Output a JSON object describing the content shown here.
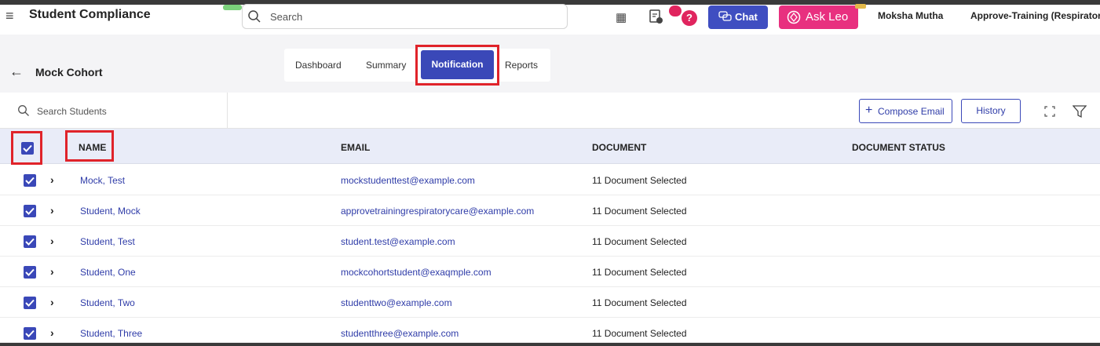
{
  "header": {
    "app_title": "Student Compliance",
    "search_placeholder": "Search",
    "help_label": "?",
    "chat_label": "Chat",
    "ask_leo_label": "Ask Leo",
    "user_name": "Moksha Mutha",
    "user_role": "Approve-Training (RespiratoryCare)"
  },
  "subheader": {
    "cohort_title": "Mock Cohort",
    "tabs": [
      {
        "label": "Dashboard",
        "active": false
      },
      {
        "label": "Summary",
        "active": false
      },
      {
        "label": "Notification",
        "active": true
      },
      {
        "label": "Reports",
        "active": false
      }
    ]
  },
  "toolbar": {
    "search_students_placeholder": "Search Students",
    "compose_email_label": "Compose Email",
    "history_label": "History"
  },
  "table": {
    "columns": [
      "NAME",
      "EMAIL",
      "DOCUMENT",
      "DOCUMENT STATUS"
    ],
    "rows": [
      {
        "name": "Mock, Test",
        "email": "mockstudenttest@example.com",
        "document": "11 Document Selected",
        "status": "",
        "checked": true
      },
      {
        "name": "Student, Mock",
        "email": "approvetrainingrespiratorycare@example.com",
        "document": "11 Document Selected",
        "status": "",
        "checked": true
      },
      {
        "name": "Student, Test",
        "email": "student.test@example.com",
        "document": "11 Document Selected",
        "status": "",
        "checked": true
      },
      {
        "name": "Student, One",
        "email": "mockcohortstudent@exaqmple.com",
        "document": "11 Document Selected",
        "status": "",
        "checked": true
      },
      {
        "name": "Student, Two",
        "email": "studenttwo@example.com",
        "document": "11 Document Selected",
        "status": "",
        "checked": true
      },
      {
        "name": "Student, Three",
        "email": "studentthree@example.com",
        "document": "11 Document Selected",
        "status": "",
        "checked": true
      }
    ]
  },
  "colors": {
    "primary": "#3a48b8",
    "ask_leo": "#e8307f",
    "alert": "#e0245e",
    "highlight": "#e0232a",
    "header_row": "#e9ecf8"
  }
}
